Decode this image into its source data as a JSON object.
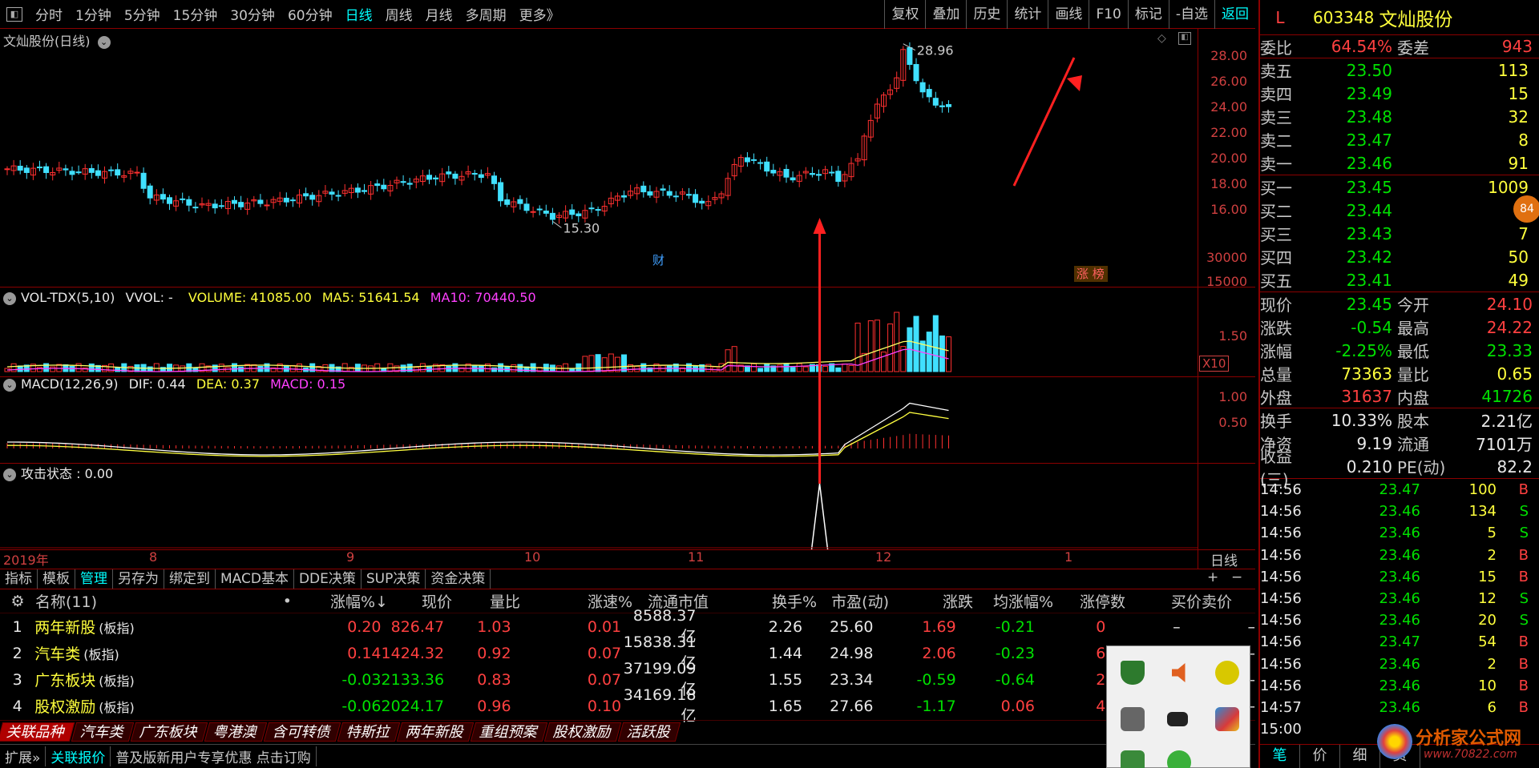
{
  "topbar": {
    "periods": [
      "分时",
      "1分钟",
      "5分钟",
      "15分钟",
      "30分钟",
      "60分钟",
      "日线",
      "周线",
      "月线",
      "多周期",
      "更多》"
    ],
    "active_period": "日线",
    "tools": [
      "复权",
      "叠加",
      "历史",
      "统计",
      "画线",
      "F10",
      "标记",
      "-自选",
      "返回"
    ]
  },
  "kline": {
    "title": "文灿股份(日线)",
    "yticks": [
      "28.00",
      "26.00",
      "24.00",
      "22.00",
      "20.00",
      "18.00",
      "16.00"
    ],
    "high_label": "28.96",
    "low_label": "15.30",
    "low_mark": "财",
    "zt_mark": "涨 榜"
  },
  "vol": {
    "title": "VOL-TDX(5,10)",
    "vvol": "VVOL: -",
    "volume_label": "VOLUME: 41085.00",
    "ma5_label": "MA5: 51641.54",
    "ma10_label": "MA10: 70440.50",
    "yticks": [
      "30000",
      "15000"
    ],
    "unit": "X10"
  },
  "macd": {
    "title": "MACD(12,26,9)",
    "dif_label": "DIF: 0.44",
    "dea_label": "DEA: 0.37",
    "macd_label": "MACD: 0.15",
    "yticks": [
      "1.50"
    ]
  },
  "attack": {
    "title": "攻击状态 : 0.00",
    "yticks": [
      "1.00",
      "0.50"
    ]
  },
  "xaxis": {
    "labels": [
      "2019年",
      "8",
      "9",
      "10",
      "11",
      "12",
      "1"
    ],
    "period": "日线"
  },
  "tabs": [
    "指标",
    "模板",
    "管理",
    "另存为",
    "绑定到",
    "MACD基本",
    "DDE决策",
    "SUP决策",
    "资金决策"
  ],
  "active_tab": "管理",
  "table": {
    "headers": [
      "名称(11)",
      "•",
      "涨幅%↓",
      "现价",
      "量比",
      "涨速%",
      "流通市值",
      "换手%",
      "市盈(动)",
      "涨跌",
      "均涨幅%",
      "涨停数",
      "买价",
      "卖价"
    ],
    "rows": [
      {
        "no": "1",
        "name": "两年新股",
        "tag": "(板指)",
        "chg": "0.20",
        "price": "826.47",
        "lb": "1.03",
        "spd": "0.01",
        "mv": "8588.37亿",
        "hs": "2.26",
        "pe": "25.60",
        "zd": "1.69",
        "avg": "-0.21",
        "zt": "0",
        "buy": "–",
        "sell": "–"
      },
      {
        "no": "2",
        "name": "汽车类",
        "tag": "(板指)",
        "chg": "0.14",
        "price": "1424.32",
        "lb": "0.92",
        "spd": "0.07",
        "mv": "15838.31亿",
        "hs": "1.44",
        "pe": "24.98",
        "zd": "2.06",
        "avg": "-0.23",
        "zt": "6",
        "buy": "–",
        "sell": "–"
      },
      {
        "no": "3",
        "name": "广东板块",
        "tag": "(板指)",
        "chg": "-0.03",
        "price": "2133.36",
        "lb": "0.83",
        "spd": "0.07",
        "mv": "37199.09亿",
        "hs": "1.55",
        "pe": "23.34",
        "zd": "-0.59",
        "avg": "-0.64",
        "zt": "2",
        "buy": "–",
        "sell": "–"
      },
      {
        "no": "4",
        "name": "股权激励",
        "tag": "(板指)",
        "chg": "-0.06",
        "price": "2024.17",
        "lb": "0.96",
        "spd": "0.10",
        "mv": "34169.18亿",
        "hs": "1.65",
        "pe": "27.66",
        "zd": "-1.17",
        "avg": "0.06",
        "zt": "4",
        "buy": "–",
        "sell": "–"
      }
    ]
  },
  "blocktabs": [
    "关联品种",
    "汽车类",
    "广东板块",
    "粤港澳",
    "含可转债",
    "特斯拉",
    "两年新股",
    "重组预案",
    "股权激励",
    "活跃股"
  ],
  "statusbar": [
    "扩展»",
    "关联报价",
    "普及版新用户专享优惠 点击订购"
  ],
  "quote": {
    "mark": "L",
    "code": "603348",
    "name": "文灿股份",
    "wb_label": "委比",
    "wb": "64.54%",
    "wc_label": "委差",
    "wc": "943",
    "sells": [
      {
        "l": "卖五",
        "p": "23.50",
        "v": "113"
      },
      {
        "l": "卖四",
        "p": "23.49",
        "v": "15"
      },
      {
        "l": "卖三",
        "p": "23.48",
        "v": "32"
      },
      {
        "l": "卖二",
        "p": "23.47",
        "v": "8"
      },
      {
        "l": "卖一",
        "p": "23.46",
        "v": "91"
      }
    ],
    "buys": [
      {
        "l": "买一",
        "p": "23.45",
        "v": "1009"
      },
      {
        "l": "买二",
        "p": "23.44",
        "v": "1"
      },
      {
        "l": "买三",
        "p": "23.43",
        "v": "7"
      },
      {
        "l": "买四",
        "p": "23.42",
        "v": "50"
      },
      {
        "l": "买五",
        "p": "23.41",
        "v": "49"
      }
    ],
    "stats": [
      {
        "k1": "现价",
        "v1": "23.45",
        "k2": "今开",
        "v2": "24.10"
      },
      {
        "k1": "涨跌",
        "v1": "-0.54",
        "k2": "最高",
        "v2": "24.22"
      },
      {
        "k1": "涨幅",
        "v1": "-2.25%",
        "k2": "最低",
        "v2": "23.33"
      },
      {
        "k1": "总量",
        "v1": "73363",
        "k2": "量比",
        "v2": "0.65"
      },
      {
        "k1": "外盘",
        "v1": "31637",
        "k2": "内盘",
        "v2": "41726"
      },
      {
        "k1": "换手",
        "v1": "10.33%",
        "k2": "股本",
        "v2": "2.21亿"
      },
      {
        "k1": "净资",
        "v1": "9.19",
        "k2": "流通",
        "v2": "7101万"
      },
      {
        "k1": "收益(三)",
        "v1": "0.210",
        "k2": "PE(动)",
        "v2": "82.2"
      }
    ],
    "ticks": [
      {
        "t": "14:56",
        "p": "23.47",
        "v": "100",
        "d": "B"
      },
      {
        "t": "14:56",
        "p": "23.46",
        "v": "134",
        "d": "S"
      },
      {
        "t": "14:56",
        "p": "23.46",
        "v": "5",
        "d": "S"
      },
      {
        "t": "14:56",
        "p": "23.46",
        "v": "2",
        "d": "B"
      },
      {
        "t": "14:56",
        "p": "23.46",
        "v": "15",
        "d": "B"
      },
      {
        "t": "14:56",
        "p": "23.46",
        "v": "12",
        "d": "S"
      },
      {
        "t": "14:56",
        "p": "23.46",
        "v": "20",
        "d": "S"
      },
      {
        "t": "14:56",
        "p": "23.47",
        "v": "54",
        "d": "B"
      },
      {
        "t": "14:56",
        "p": "23.46",
        "v": "2",
        "d": "B"
      },
      {
        "t": "14:56",
        "p": "23.46",
        "v": "10",
        "d": "B"
      },
      {
        "t": "14:57",
        "p": "23.46",
        "v": "6",
        "d": "B"
      },
      {
        "t": "15:00",
        "p": "",
        "v": "",
        "d": ""
      }
    ],
    "bottom_tabs": [
      "笔",
      "价",
      "细",
      "资"
    ],
    "badge": "84"
  },
  "watermark": {
    "brand": "分析家公式网",
    "url": "www.70822.com"
  }
}
